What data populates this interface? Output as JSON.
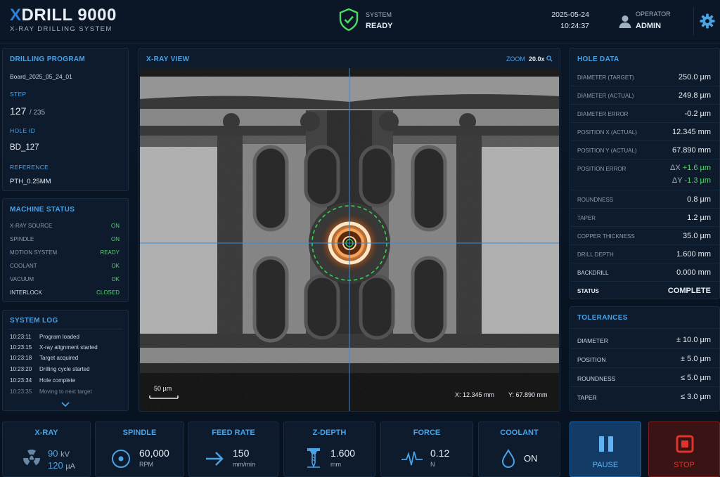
{
  "header": {
    "logo_x": "X",
    "logo_rest": "DRILL 9000",
    "subtitle": "X-RAY DRILLING SYSTEM",
    "system_label": "SYSTEM",
    "system_value": "READY",
    "date": "2025-05-24",
    "time": "10:24:37",
    "operator_label": "OPERATOR",
    "operator_value": "ADMIN"
  },
  "program": {
    "title": "DRILLING PROGRAM",
    "name": "Board_2025_05_24_01",
    "step_label": "STEP",
    "step_value": "127",
    "step_total": "/ 235",
    "hole_label": "HOLE ID",
    "hole_value": "BD_127",
    "ref_label": "REFERENCE",
    "ref_value": "PTH_0.25MM"
  },
  "machine": {
    "title": "MACHINE STATUS",
    "items": [
      {
        "k": "X-RAY SOURCE",
        "v": "ON"
      },
      {
        "k": "SPINDLE",
        "v": "ON"
      },
      {
        "k": "MOTION SYSTEM",
        "v": "READY"
      },
      {
        "k": "COOLANT",
        "v": "OK"
      },
      {
        "k": "VACUUM",
        "v": "OK"
      },
      {
        "k": "INTERLOCK",
        "v": "CLOSED"
      }
    ]
  },
  "log": {
    "title": "SYSTEM LOG",
    "items": [
      {
        "t": "10:23:11",
        "m": "Program loaded"
      },
      {
        "t": "10:23:15",
        "m": "X-ray alignment started"
      },
      {
        "t": "10:23:18",
        "m": "Target acquired"
      },
      {
        "t": "10:23:20",
        "m": "Drilling cycle started"
      },
      {
        "t": "10:23:34",
        "m": "Hole complete"
      },
      {
        "t": "10:23:35",
        "m": "Moving to next target"
      }
    ]
  },
  "xray": {
    "title": "X-RAY VIEW",
    "zoom_label": "ZOOM",
    "zoom_value": "20.0x",
    "scale": "50 µm",
    "x_readout": "X: 12.345 mm",
    "y_readout": "Y: 67.890 mm"
  },
  "hole": {
    "title": "HOLE DATA",
    "diam_t_k": "DIAMETER (TARGET)",
    "diam_t_v": "250.0 µm",
    "diam_a_k": "DIAMETER (ACTUAL)",
    "diam_a_v": "249.8 µm",
    "diam_e_k": "DIAMETER ERROR",
    "diam_e_v": "-0.2 µm",
    "posx_k": "POSITION X (ACTUAL)",
    "posx_v": "12.345 mm",
    "posy_k": "POSITION Y (ACTUAL)",
    "posy_v": "67.890 mm",
    "pose_k": "POSITION ERROR",
    "pose_dx_l": "ΔX",
    "pose_dx_v": "+1.6 µm",
    "pose_dy_l": "ΔY",
    "pose_dy_v": "-1.3 µm",
    "round_k": "ROUNDNESS",
    "round_v": "0.8 µm",
    "taper_k": "TAPER",
    "taper_v": "1.2 µm",
    "cu_k": "COPPER THICKNESS",
    "cu_v": "35.0 µm",
    "depth_k": "DRILL DEPTH",
    "depth_v": "1.600 mm",
    "back_k": "BACKDRILL",
    "back_v": "0.000 mm",
    "status_k": "STATUS",
    "status_v": "COMPLETE"
  },
  "tolerances": {
    "title": "TOLERANCES",
    "items": [
      {
        "k": "DIAMETER",
        "v": "± 10.0 µm"
      },
      {
        "k": "POSITION",
        "v": "± 5.0 µm"
      },
      {
        "k": "ROUNDNESS",
        "v": "≤ 5.0 µm"
      },
      {
        "k": "TAPER",
        "v": "≤ 3.0 µm"
      }
    ]
  },
  "bottom": {
    "xray": {
      "title": "X-RAY",
      "kv": "90",
      "kv_u": "kV",
      "ua": "120",
      "ua_u": "µA"
    },
    "spindle": {
      "title": "SPINDLE",
      "value": "60,000",
      "unit": "RPM"
    },
    "feed": {
      "title": "FEED RATE",
      "value": "150",
      "unit": "mm/min"
    },
    "zdepth": {
      "title": "Z-DEPTH",
      "value": "1.600",
      "unit": "mm"
    },
    "force": {
      "title": "FORCE",
      "value": "0.12",
      "unit": "N"
    },
    "coolant": {
      "title": "COOLANT",
      "value": "ON"
    },
    "pause": "PAUSE",
    "stop": "STOP"
  },
  "colors": {
    "accent": "#4aa3e6",
    "ok": "#4cd964",
    "stop": "#e0332b",
    "background": "#081320"
  }
}
